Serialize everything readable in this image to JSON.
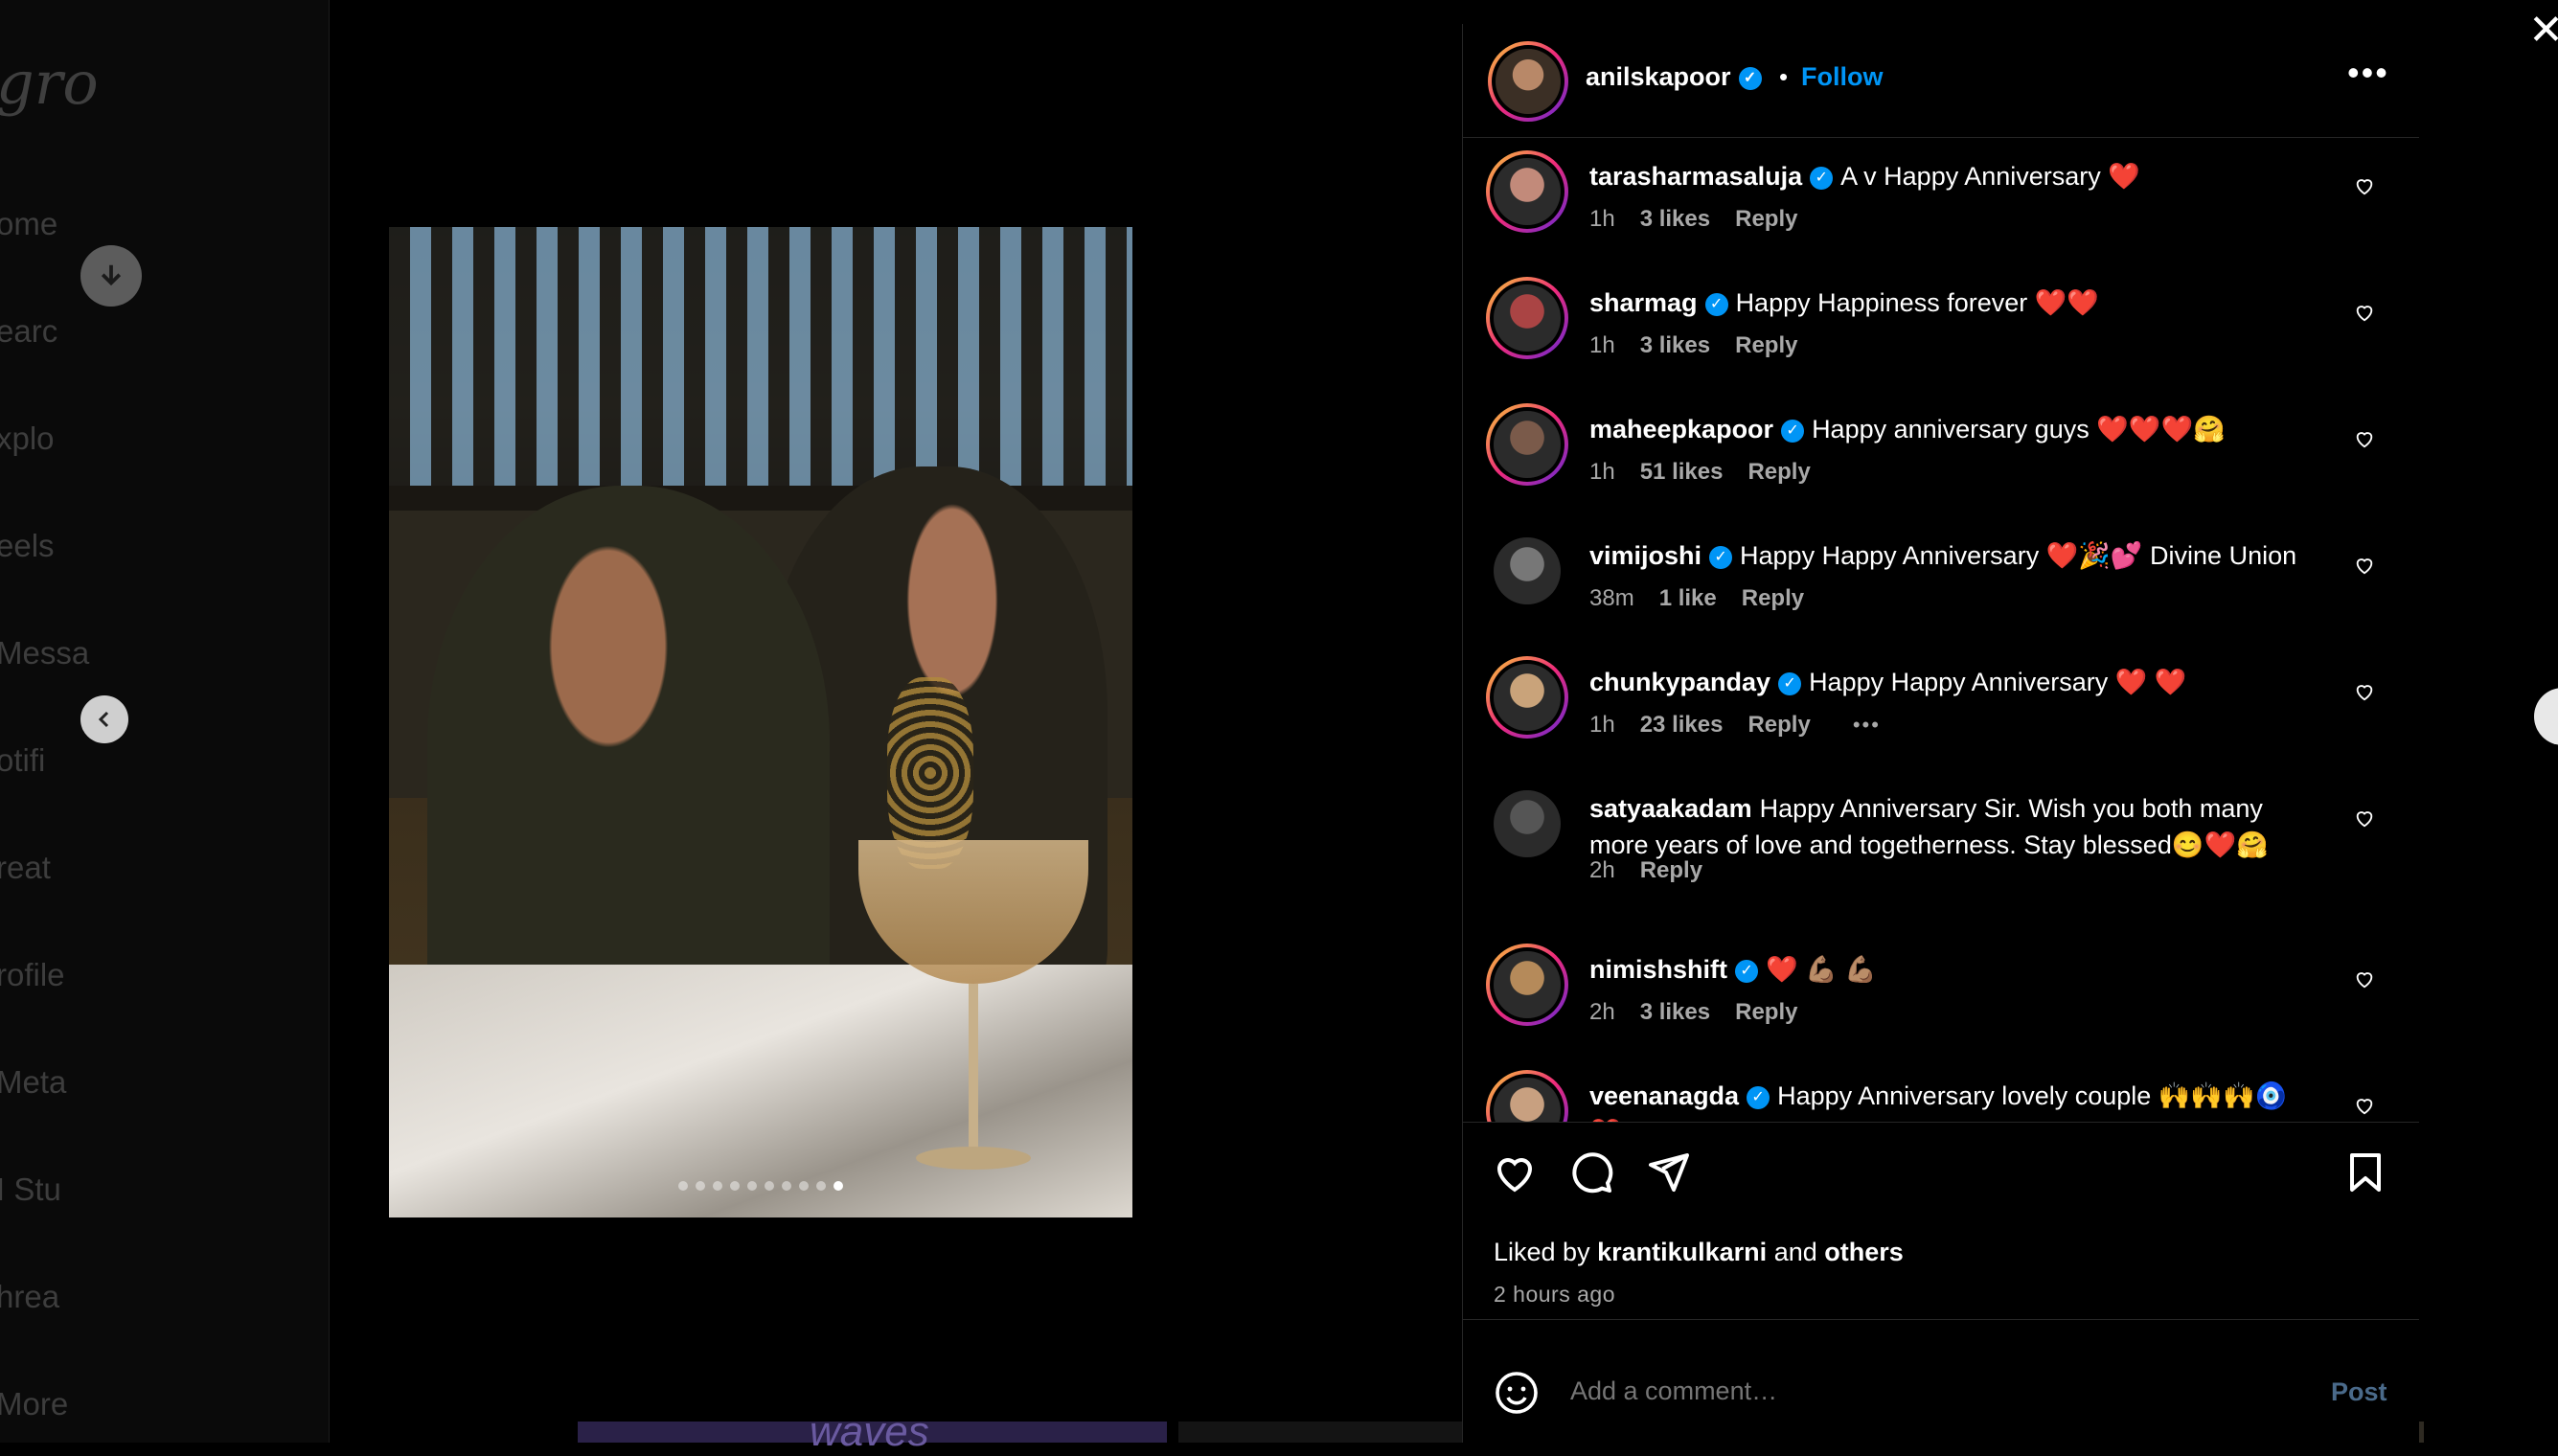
{
  "background": {
    "logo": "gro",
    "nav": [
      "ome",
      "earc",
      "xplo",
      "eels",
      "Messa",
      "otifi",
      "reat",
      "rofile",
      "Meta",
      "I Stu",
      "hrea",
      "More"
    ],
    "strip_text": "waves"
  },
  "post": {
    "author": "anilskapoor",
    "follow_label": "Follow",
    "more_label": "•••",
    "carousel": {
      "count": 10,
      "active_index": 9
    }
  },
  "comments": [
    {
      "user": "tarasharmasaluja",
      "verified": true,
      "text": "A v Happy Anniversary ❤️",
      "time": "1h",
      "likes": "3 likes",
      "reply": "Reply"
    },
    {
      "user": "sharmag",
      "verified": true,
      "text": "Happy Happiness forever ❤️❤️",
      "time": "1h",
      "likes": "3 likes",
      "reply": "Reply"
    },
    {
      "user": "maheepkapoor",
      "verified": true,
      "text": "Happy anniversary guys ❤️❤️❤️🤗",
      "time": "1h",
      "likes": "51 likes",
      "reply": "Reply"
    },
    {
      "user": "vimijoshi",
      "verified": true,
      "text": "Happy Happy Anniversary ❤️🎉💕 Divine Union",
      "time": "38m",
      "likes": "1 like",
      "reply": "Reply"
    },
    {
      "user": "chunkypanday",
      "verified": true,
      "text": "Happy Happy Anniversary ❤️ ❤️",
      "time": "1h",
      "likes": "23 likes",
      "reply": "Reply",
      "more": "•••"
    },
    {
      "user": "satyaakadam",
      "verified": false,
      "text": "Happy Anniversary Sir. Wish you both many more years of love and togetherness. Stay blessed😊❤️🤗",
      "time": "2h",
      "likes": "",
      "reply": "Reply"
    },
    {
      "user": "nimishshift",
      "verified": true,
      "text": "❤️ 💪🏽 💪🏽",
      "time": "2h",
      "likes": "3 likes",
      "reply": "Reply"
    },
    {
      "user": "veenanagda",
      "verified": true,
      "text": "Happy Anniversary lovely couple 🙌🙌🙌🧿❤️",
      "time": "",
      "likes": "",
      "reply": ""
    }
  ],
  "actions": {
    "liked_by_prefix": "Liked by",
    "liked_by_user": "krantikulkarni",
    "liked_by_and": "and",
    "liked_by_others": "others",
    "time_ago": "2 hours ago"
  },
  "comment_box": {
    "placeholder": "Add a comment…",
    "post_label": "Post"
  },
  "colors": {
    "accent": "#0095f6",
    "heart": "#ff3040",
    "muted": "#a8a8a8"
  }
}
